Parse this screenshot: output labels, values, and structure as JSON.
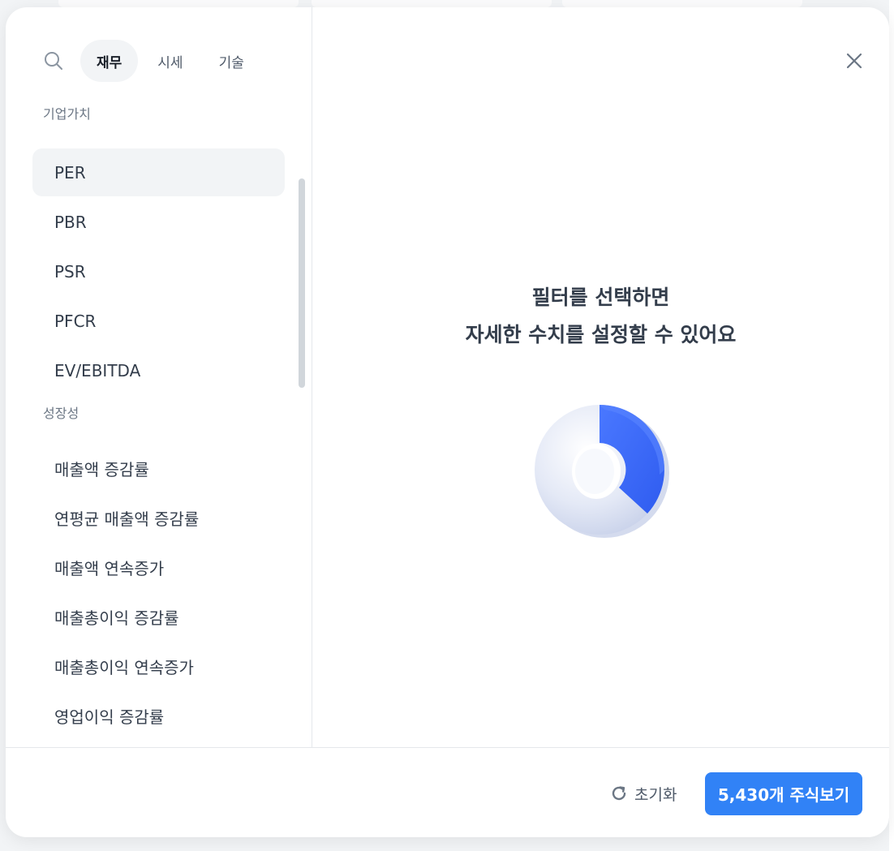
{
  "tabs": [
    {
      "label": "재무",
      "active": true
    },
    {
      "label": "시세",
      "active": false
    },
    {
      "label": "기술",
      "active": false
    }
  ],
  "groups": [
    {
      "title": "기업가치",
      "items": [
        "PER",
        "PBR",
        "PSR",
        "PFCR",
        "EV/EBITDA"
      ]
    },
    {
      "title": "성장성",
      "items": [
        "매출액 증감률",
        "연평균 매출액 증감률",
        "매출액 연속증가",
        "매출총이익 증감률",
        "매출총이익 연속증가",
        "영업이익 증감률"
      ]
    }
  ],
  "selected_item": "PER",
  "empty_state": {
    "line1": "필터를 선택하면",
    "line2": "자세한 수치를 설정할 수 있어요"
  },
  "footer": {
    "reset_label": "초기화",
    "primary_label": "5,430개 주식보기"
  },
  "colors": {
    "accent": "#3182f6",
    "ring_blue": "#3c6cf8",
    "ring_light": "#dde4f5"
  },
  "icons": {
    "search": "search-icon",
    "close": "close-icon",
    "reset": "refresh-icon"
  }
}
